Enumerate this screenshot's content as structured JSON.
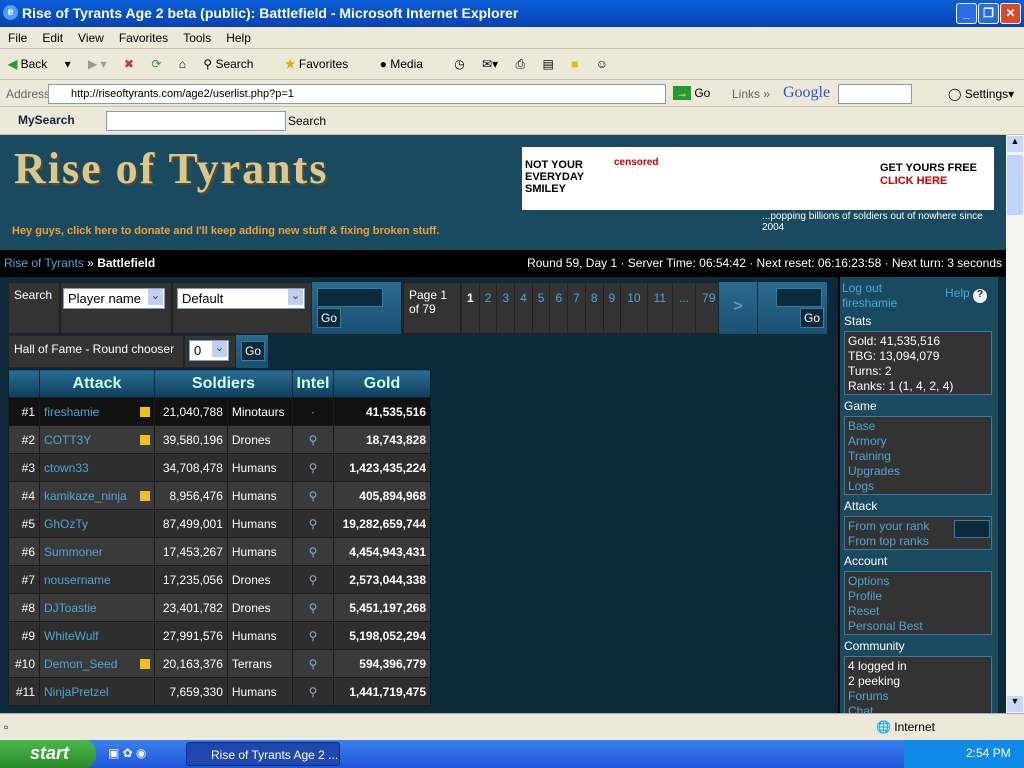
{
  "window": {
    "title": "Rise of Tyrants Age 2 beta (public): Battlefield - Microsoft Internet Explorer"
  },
  "menu": [
    "File",
    "Edit",
    "View",
    "Favorites",
    "Tools",
    "Help"
  ],
  "toolbar": {
    "back": "Back",
    "search": "Search",
    "favorites": "Favorites",
    "media": "Media"
  },
  "address": {
    "label": "Address",
    "url": "http://riseoftyrants.com/age2/userlist.php?p=1",
    "go": "Go",
    "links": "Links",
    "google": "Google",
    "settings": "Settings"
  },
  "mysearch": {
    "brand": "MySearch",
    "button": "Search"
  },
  "site": {
    "logo": "Rise of Tyrants",
    "ad": {
      "line1": "NOT YOUR EVERYDAY SMILEY",
      "censored": "censored",
      "cta1": "GET YOURS FREE",
      "cta2": "CLICK HERE"
    },
    "tagline": "...popping billions of soldiers out of nowhere since 2004",
    "donate": "Hey guys, click here to donate and I'll keep adding new stuff & fixing broken stuff."
  },
  "breadcrumb": {
    "home": "Rise of Tyrants",
    "sep": "»",
    "current": "Battlefield"
  },
  "status_line": "Round 59, Day 1 · Server Time: 06:54:42 · Next reset: 06:16:23:58 · Next turn: 3 seconds",
  "search": {
    "label": "Search",
    "field": "Player name",
    "sort": "Default",
    "go": "Go"
  },
  "pagination": {
    "label": "Page 1 of 79",
    "pages": [
      "1",
      "2",
      "3",
      "4",
      "5",
      "6",
      "7",
      "8",
      "9",
      "10",
      "11",
      "...",
      "79"
    ],
    "next": ">",
    "go": "Go"
  },
  "hof": {
    "label": "Hall of Fame - Round chooser",
    "value": "0",
    "go": "Go"
  },
  "table": {
    "headers": [
      "",
      "Attack",
      "Soldiers",
      "Intel",
      "Gold"
    ],
    "rows": [
      {
        "rank": "#1",
        "name": "fireshamie",
        "flag": true,
        "soldiers": "21,040,788",
        "race": "Minotaurs",
        "gold": "41,535,516"
      },
      {
        "rank": "#2",
        "name": "COTT3Y",
        "flag": true,
        "soldiers": "39,580,196",
        "race": "Drones",
        "gold": "18,743,828"
      },
      {
        "rank": "#3",
        "name": "ctown33",
        "flag": false,
        "soldiers": "34,708,478",
        "race": "Humans",
        "gold": "1,423,435,224"
      },
      {
        "rank": "#4",
        "name": "kamikaze_ninja",
        "flag": true,
        "soldiers": "8,956,476",
        "race": "Humans",
        "gold": "405,894,968"
      },
      {
        "rank": "#5",
        "name": "GhOzTy",
        "flag": false,
        "soldiers": "87,499,001",
        "race": "Humans",
        "gold": "19,282,659,744"
      },
      {
        "rank": "#6",
        "name": "Summoner",
        "flag": false,
        "soldiers": "17,453,267",
        "race": "Humans",
        "gold": "4,454,943,431"
      },
      {
        "rank": "#7",
        "name": "nousername",
        "flag": false,
        "soldiers": "17,235,056",
        "race": "Drones",
        "gold": "2,573,044,338"
      },
      {
        "rank": "#8",
        "name": "DJToastie",
        "flag": false,
        "soldiers": "23,401,782",
        "race": "Drones",
        "gold": "5,451,197,268"
      },
      {
        "rank": "#9",
        "name": "WhiteWulf",
        "flag": false,
        "soldiers": "27,991,576",
        "race": "Humans",
        "gold": "5,198,052,294"
      },
      {
        "rank": "#10",
        "name": "Demon_Seed",
        "flag": true,
        "soldiers": "20,163,376",
        "race": "Terrans",
        "gold": "594,396,779"
      },
      {
        "rank": "#11",
        "name": "NinjaPretzel",
        "flag": false,
        "soldiers": "7,659,330",
        "race": "Humans",
        "gold": "1,441,719,475"
      }
    ]
  },
  "sidebar": {
    "logout": "Log out",
    "user": "fireshamie",
    "help": "Help",
    "stats_title": "Stats",
    "stats": [
      "Gold: 41,535,516",
      "TBG: 13,094,079",
      "Turns: 2",
      "Ranks: 1 (1, 4, 2, 4)"
    ],
    "game_title": "Game",
    "game": [
      "Base",
      "Armory",
      "Training",
      "Upgrades",
      "Logs"
    ],
    "attack_title": "Attack",
    "attack": [
      "From your rank",
      "From top ranks"
    ],
    "account_title": "Account",
    "account": [
      "Options",
      "Profile",
      "Reset",
      "Personal Best"
    ],
    "community_title": "Community",
    "community_stats": [
      "4 logged in",
      "2 peeking"
    ],
    "community": [
      "Forums",
      "Chat"
    ]
  },
  "statusbar": {
    "zone": "Internet"
  },
  "taskbar": {
    "start": "start",
    "task": "Rise of Tyrants Age 2 ...",
    "clock": "2:54 PM"
  }
}
